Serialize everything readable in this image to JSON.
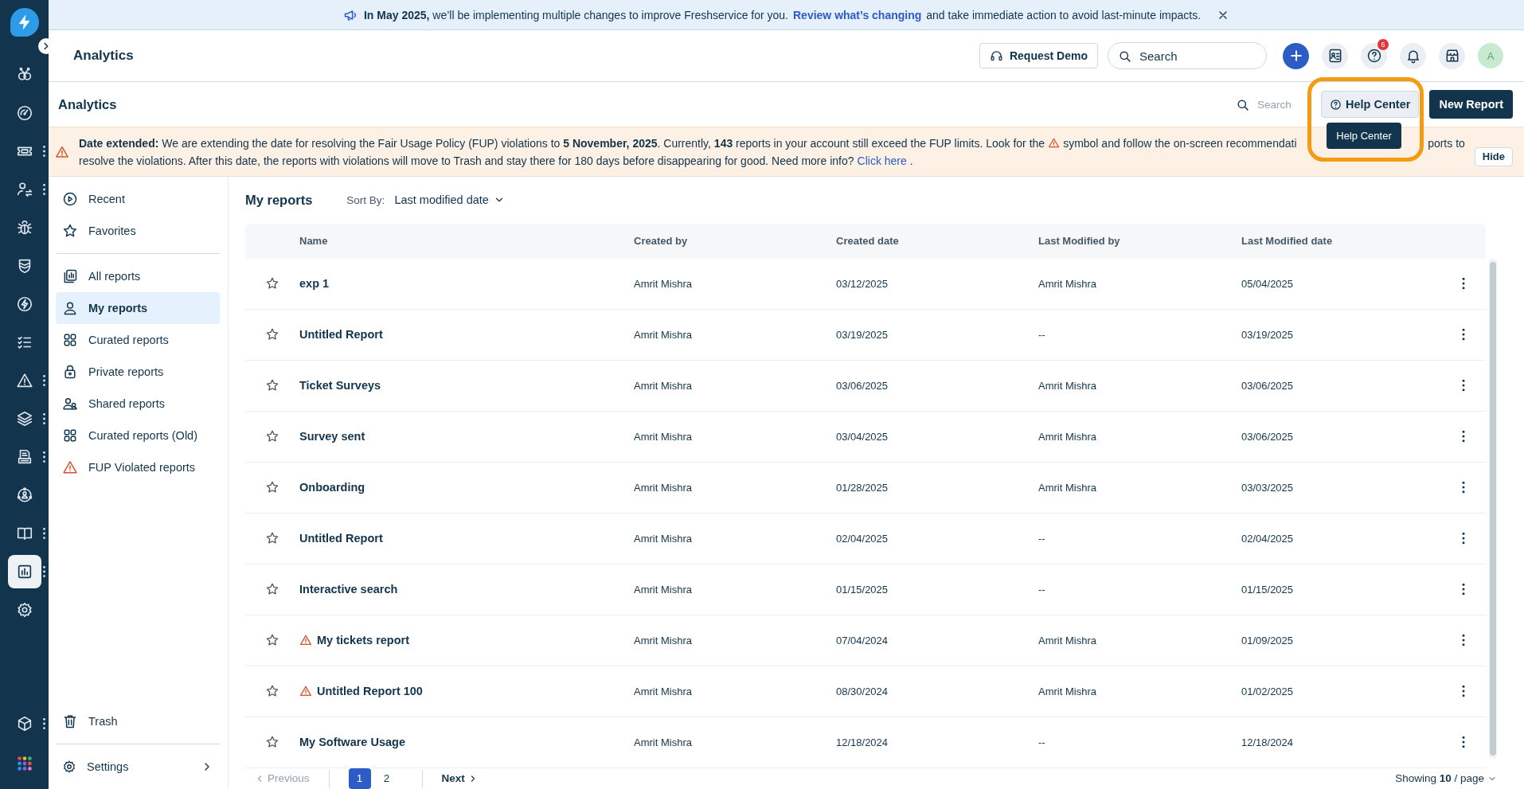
{
  "rail": {
    "items": [
      {
        "kind": "linked-circles",
        "selected": false,
        "menu": false
      },
      {
        "kind": "gauge",
        "selected": false,
        "menu": false
      },
      {
        "kind": "ticket",
        "selected": false,
        "menu": true
      },
      {
        "kind": "user-swap",
        "selected": false,
        "menu": true
      },
      {
        "kind": "bug",
        "selected": false,
        "menu": false
      },
      {
        "kind": "shield",
        "selected": false,
        "menu": false
      },
      {
        "kind": "bolt-circle",
        "selected": false,
        "menu": false
      },
      {
        "kind": "checklist",
        "selected": false,
        "menu": false
      },
      {
        "kind": "warning",
        "selected": false,
        "menu": true
      },
      {
        "kind": "layers",
        "selected": false,
        "menu": true
      },
      {
        "kind": "printer",
        "selected": false,
        "menu": true
      },
      {
        "kind": "people-circle",
        "selected": false,
        "menu": false
      },
      {
        "kind": "book",
        "selected": false,
        "menu": true
      },
      {
        "kind": "chart",
        "selected": true,
        "menu": true
      },
      {
        "kind": "gear",
        "selected": false,
        "menu": false
      }
    ],
    "bottom": [
      {
        "kind": "cube",
        "selected": false,
        "menu": true
      },
      {
        "kind": "apps",
        "selected": false,
        "menu": false
      }
    ]
  },
  "announcement": {
    "text": "**In May 2025,** we’ll be implementing multiple changes to improve Freshservice for you.",
    "link": "Review what’s changing",
    "tail": "and take immediate action to avoid last-minute impacts."
  },
  "header": {
    "title": "Analytics",
    "request_demo": "Request Demo",
    "search_placeholder": "Search",
    "help_badge": "6",
    "avatar": "A"
  },
  "toolbar": {
    "title": "Analytics",
    "search_placeholder": "Search",
    "help_center": "Help Center",
    "tooltip": "Help Center",
    "new_report": "New Report"
  },
  "banner": {
    "lines": [
      [
        {
          "kind": "text",
          "text": "**Date extended:** We are extending the date for resolving the Fair Usage Policy (FUP) violations to **5 November, 2025**. Currently, **143** reports in your account still exceed the FUP limits. Look for the"
        },
        {
          "kind": "warning"
        },
        {
          "kind": "text",
          "text": "symbol and follow the on-screen recommendati"
        },
        {
          "kind": "text",
          "text": "ports to"
        }
      ],
      [
        {
          "kind": "text",
          "text": "resolve the violations. After this date, the reports with violations will move to Trash and stay there for 180 days before disappearing for good. Need more info?"
        },
        {
          "kind": "link",
          "text": "Click here"
        },
        {
          "kind": "text",
          "text": "."
        }
      ]
    ],
    "hide": "Hide"
  },
  "nav": {
    "top": [
      {
        "kind": "play",
        "label": "Recent",
        "selected": false
      },
      {
        "kind": "star",
        "label": "Favorites",
        "selected": false
      }
    ],
    "reports": [
      {
        "kind": "stack",
        "label": "All reports",
        "selected": false
      },
      {
        "kind": "user",
        "label": "My reports",
        "selected": true
      },
      {
        "kind": "grid",
        "label": "Curated reports",
        "selected": false
      },
      {
        "kind": "lock",
        "label": "Private reports",
        "selected": false
      },
      {
        "kind": "users",
        "label": "Shared reports",
        "selected": false
      },
      {
        "kind": "grid",
        "label": "Curated reports (Old)",
        "selected": false
      },
      {
        "kind": "warning",
        "label": "FUP Violated reports",
        "selected": false
      }
    ],
    "trash": "Trash",
    "settings": "Settings"
  },
  "list": {
    "title": "My reports",
    "sort_label": "Sort By:",
    "sort_value": "Last modified date",
    "columns": [
      "Name",
      "Created by",
      "Created date",
      "Last Modified by",
      "Last Modified date"
    ],
    "rows": [
      {
        "name": "exp 1",
        "warning": false,
        "starred": false,
        "created_by": "Amrit Mishra",
        "created_date": "03/12/2025",
        "modified_by": "Amrit Mishra",
        "modified_date": "05/04/2025"
      },
      {
        "name": "Untitled Report",
        "warning": false,
        "starred": false,
        "created_by": "Amrit Mishra",
        "created_date": "03/19/2025",
        "modified_by": "--",
        "modified_date": "03/19/2025"
      },
      {
        "name": "Ticket Surveys",
        "warning": false,
        "starred": false,
        "created_by": "Amrit Mishra",
        "created_date": "03/06/2025",
        "modified_by": "Amrit Mishra",
        "modified_date": "03/06/2025"
      },
      {
        "name": "Survey sent",
        "warning": false,
        "starred": false,
        "created_by": "Amrit Mishra",
        "created_date": "03/04/2025",
        "modified_by": "Amrit Mishra",
        "modified_date": "03/06/2025"
      },
      {
        "name": "Onboarding",
        "warning": false,
        "starred": false,
        "created_by": "Amrit Mishra",
        "created_date": "01/28/2025",
        "modified_by": "Amrit Mishra",
        "modified_date": "03/03/2025"
      },
      {
        "name": "Untitled Report",
        "warning": false,
        "starred": false,
        "created_by": "Amrit Mishra",
        "created_date": "02/04/2025",
        "modified_by": "--",
        "modified_date": "02/04/2025"
      },
      {
        "name": "Interactive search",
        "warning": false,
        "starred": false,
        "created_by": "Amrit Mishra",
        "created_date": "01/15/2025",
        "modified_by": "--",
        "modified_date": "01/15/2025"
      },
      {
        "name": "My tickets report",
        "warning": true,
        "starred": false,
        "created_by": "Amrit Mishra",
        "created_date": "07/04/2024",
        "modified_by": "Amrit Mishra",
        "modified_date": "01/09/2025"
      },
      {
        "name": "Untitled Report 100",
        "warning": true,
        "starred": false,
        "created_by": "Amrit Mishra",
        "created_date": "08/30/2024",
        "modified_by": "Amrit Mishra",
        "modified_date": "01/02/2025"
      },
      {
        "name": "My Software Usage",
        "warning": false,
        "starred": false,
        "created_by": "Amrit Mishra",
        "created_date": "12/18/2024",
        "modified_by": "--",
        "modified_date": "12/18/2024"
      }
    ],
    "pagination": {
      "previous": {
        "label": "Previous",
        "disabled": true
      },
      "pages": [
        {
          "label": "1",
          "selected": true
        },
        {
          "label": "2",
          "selected": false
        }
      ],
      "next": {
        "label": "Next",
        "disabled": false
      },
      "showing": "Showing **10** / page"
    }
  }
}
